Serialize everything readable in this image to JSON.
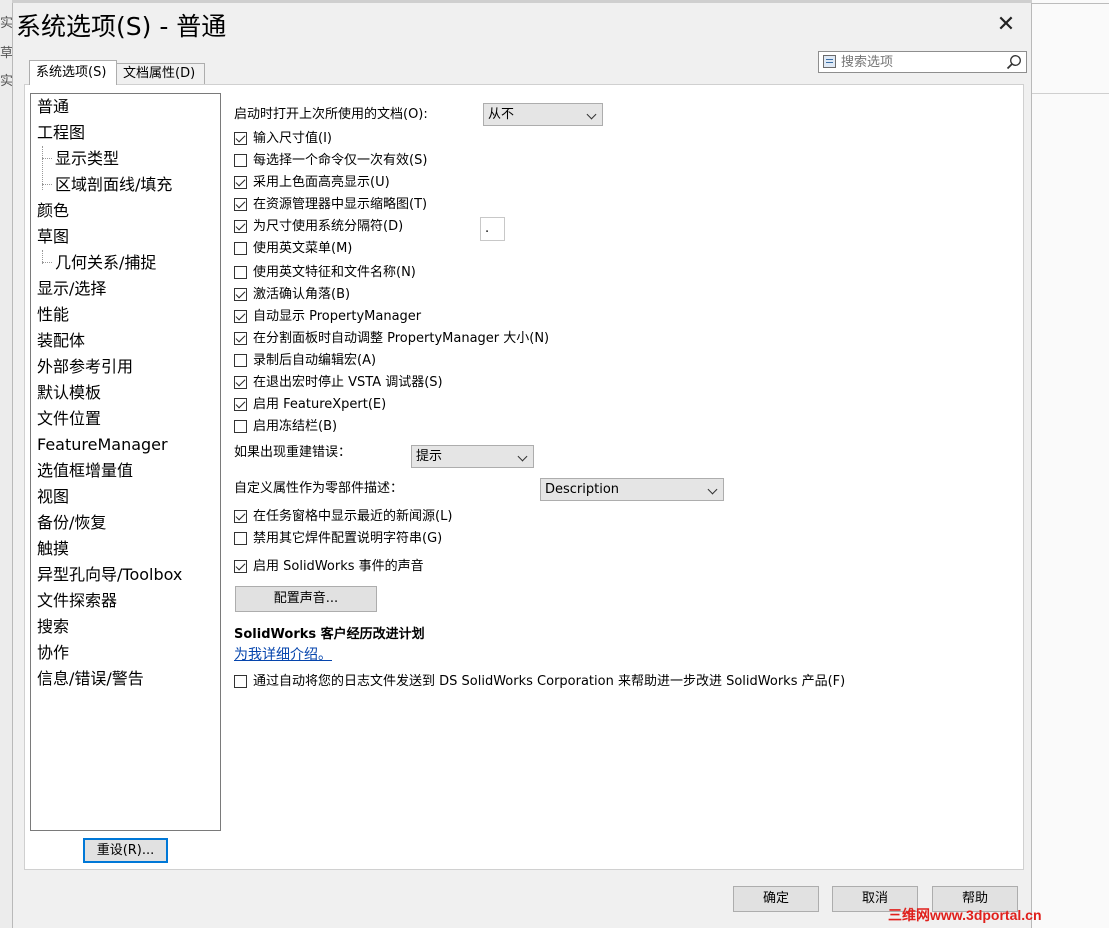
{
  "background": {
    "left_strip_chars": [
      "实",
      "草",
      "实"
    ]
  },
  "dialog": {
    "title": "系统选项(S) - 普通",
    "close_glyph": "✕"
  },
  "tabs": [
    {
      "label": "系统选项(S)",
      "active": true
    },
    {
      "label": "文档属性(D)",
      "active": false
    }
  ],
  "search": {
    "placeholder": "搜索选项"
  },
  "tree": {
    "items": [
      {
        "label": "普通",
        "level": 0,
        "selected": true
      },
      {
        "label": "工程图",
        "level": 0
      },
      {
        "label": "显示类型",
        "level": 1
      },
      {
        "label": "区域剖面线/填充",
        "level": 1
      },
      {
        "label": "颜色",
        "level": 0
      },
      {
        "label": "草图",
        "level": 0
      },
      {
        "label": "几何关系/捕捉",
        "level": 1
      },
      {
        "label": "显示/选择",
        "level": 0
      },
      {
        "label": "性能",
        "level": 0
      },
      {
        "label": "装配体",
        "level": 0
      },
      {
        "label": "外部参考引用",
        "level": 0
      },
      {
        "label": "默认模板",
        "level": 0
      },
      {
        "label": "文件位置",
        "level": 0
      },
      {
        "label": "FeatureManager",
        "level": 0
      },
      {
        "label": "选值框增量值",
        "level": 0
      },
      {
        "label": "视图",
        "level": 0
      },
      {
        "label": "备份/恢复",
        "level": 0
      },
      {
        "label": "触摸",
        "level": 0
      },
      {
        "label": "异型孔向导/Toolbox",
        "level": 0
      },
      {
        "label": "文件探索器",
        "level": 0
      },
      {
        "label": "搜索",
        "level": 0
      },
      {
        "label": "协作",
        "level": 0
      },
      {
        "label": "信息/错误/警告",
        "level": 0
      }
    ],
    "reset_button": "重设(R)..."
  },
  "settings": {
    "open_last_doc_label": "启动时打开上次所使用的文档(O):",
    "open_last_doc_value": "从不",
    "checkboxes_a": [
      {
        "label": "输入尺寸值(I)",
        "checked": true
      },
      {
        "label": "每选择一个命令仅一次有效(S)",
        "checked": false
      },
      {
        "label": "采用上色面高亮显示(U)",
        "checked": true
      },
      {
        "label": "在资源管理器中显示缩略图(T)",
        "checked": true
      },
      {
        "label": "为尺寸使用系统分隔符(D)",
        "checked": true
      },
      {
        "label": "使用英文菜单(M)",
        "checked": false
      },
      {
        "label": "使用英文特征和文件名称(N)",
        "checked": false
      },
      {
        "label": "激活确认角落(B)",
        "checked": true
      },
      {
        "label": "自动显示 PropertyManager",
        "checked": true
      },
      {
        "label": "在分割面板时自动调整 PropertyManager 大小(N)",
        "checked": true
      },
      {
        "label": "录制后自动编辑宏(A)",
        "checked": false
      },
      {
        "label": "在退出宏时停止 VSTA 调试器(S)",
        "checked": true
      },
      {
        "label": "启用 FeatureXpert(E)",
        "checked": true
      },
      {
        "label": "启用冻结栏(B)",
        "checked": false
      }
    ],
    "separator_value": ".",
    "rebuild_error_label": "如果出现重建错误：",
    "rebuild_error_value": "提示",
    "custom_prop_label": "自定义属性作为零部件描述：",
    "custom_prop_value": "Description",
    "checkboxes_b": [
      {
        "label": "在任务窗格中显示最近的新闻源(L)",
        "checked": true
      },
      {
        "label": "禁用其它焊件配置说明字符串(G)",
        "checked": false
      }
    ],
    "sound_checkbox": {
      "label": "启用 SolidWorks 事件的声音",
      "checked": true
    },
    "config_sound_button": "配置声音...",
    "cei_heading": "SolidWorks 客户经历改进计划",
    "cei_link": "为我详细介绍。",
    "cei_checkbox": {
      "label": "通过自动将您的日志文件发送到 DS SolidWorks Corporation 来帮助进一步改进 SolidWorks 产品(F)",
      "checked": false
    }
  },
  "footer": {
    "ok": "确定",
    "cancel": "取消",
    "help": "帮助"
  },
  "watermark": "三维网www.3dportal.cn",
  "colors": {
    "dialog_bg": "#f0f0f0",
    "focus_border": "#0078d7",
    "link": "#0645ad",
    "watermark": "#e0201c"
  }
}
